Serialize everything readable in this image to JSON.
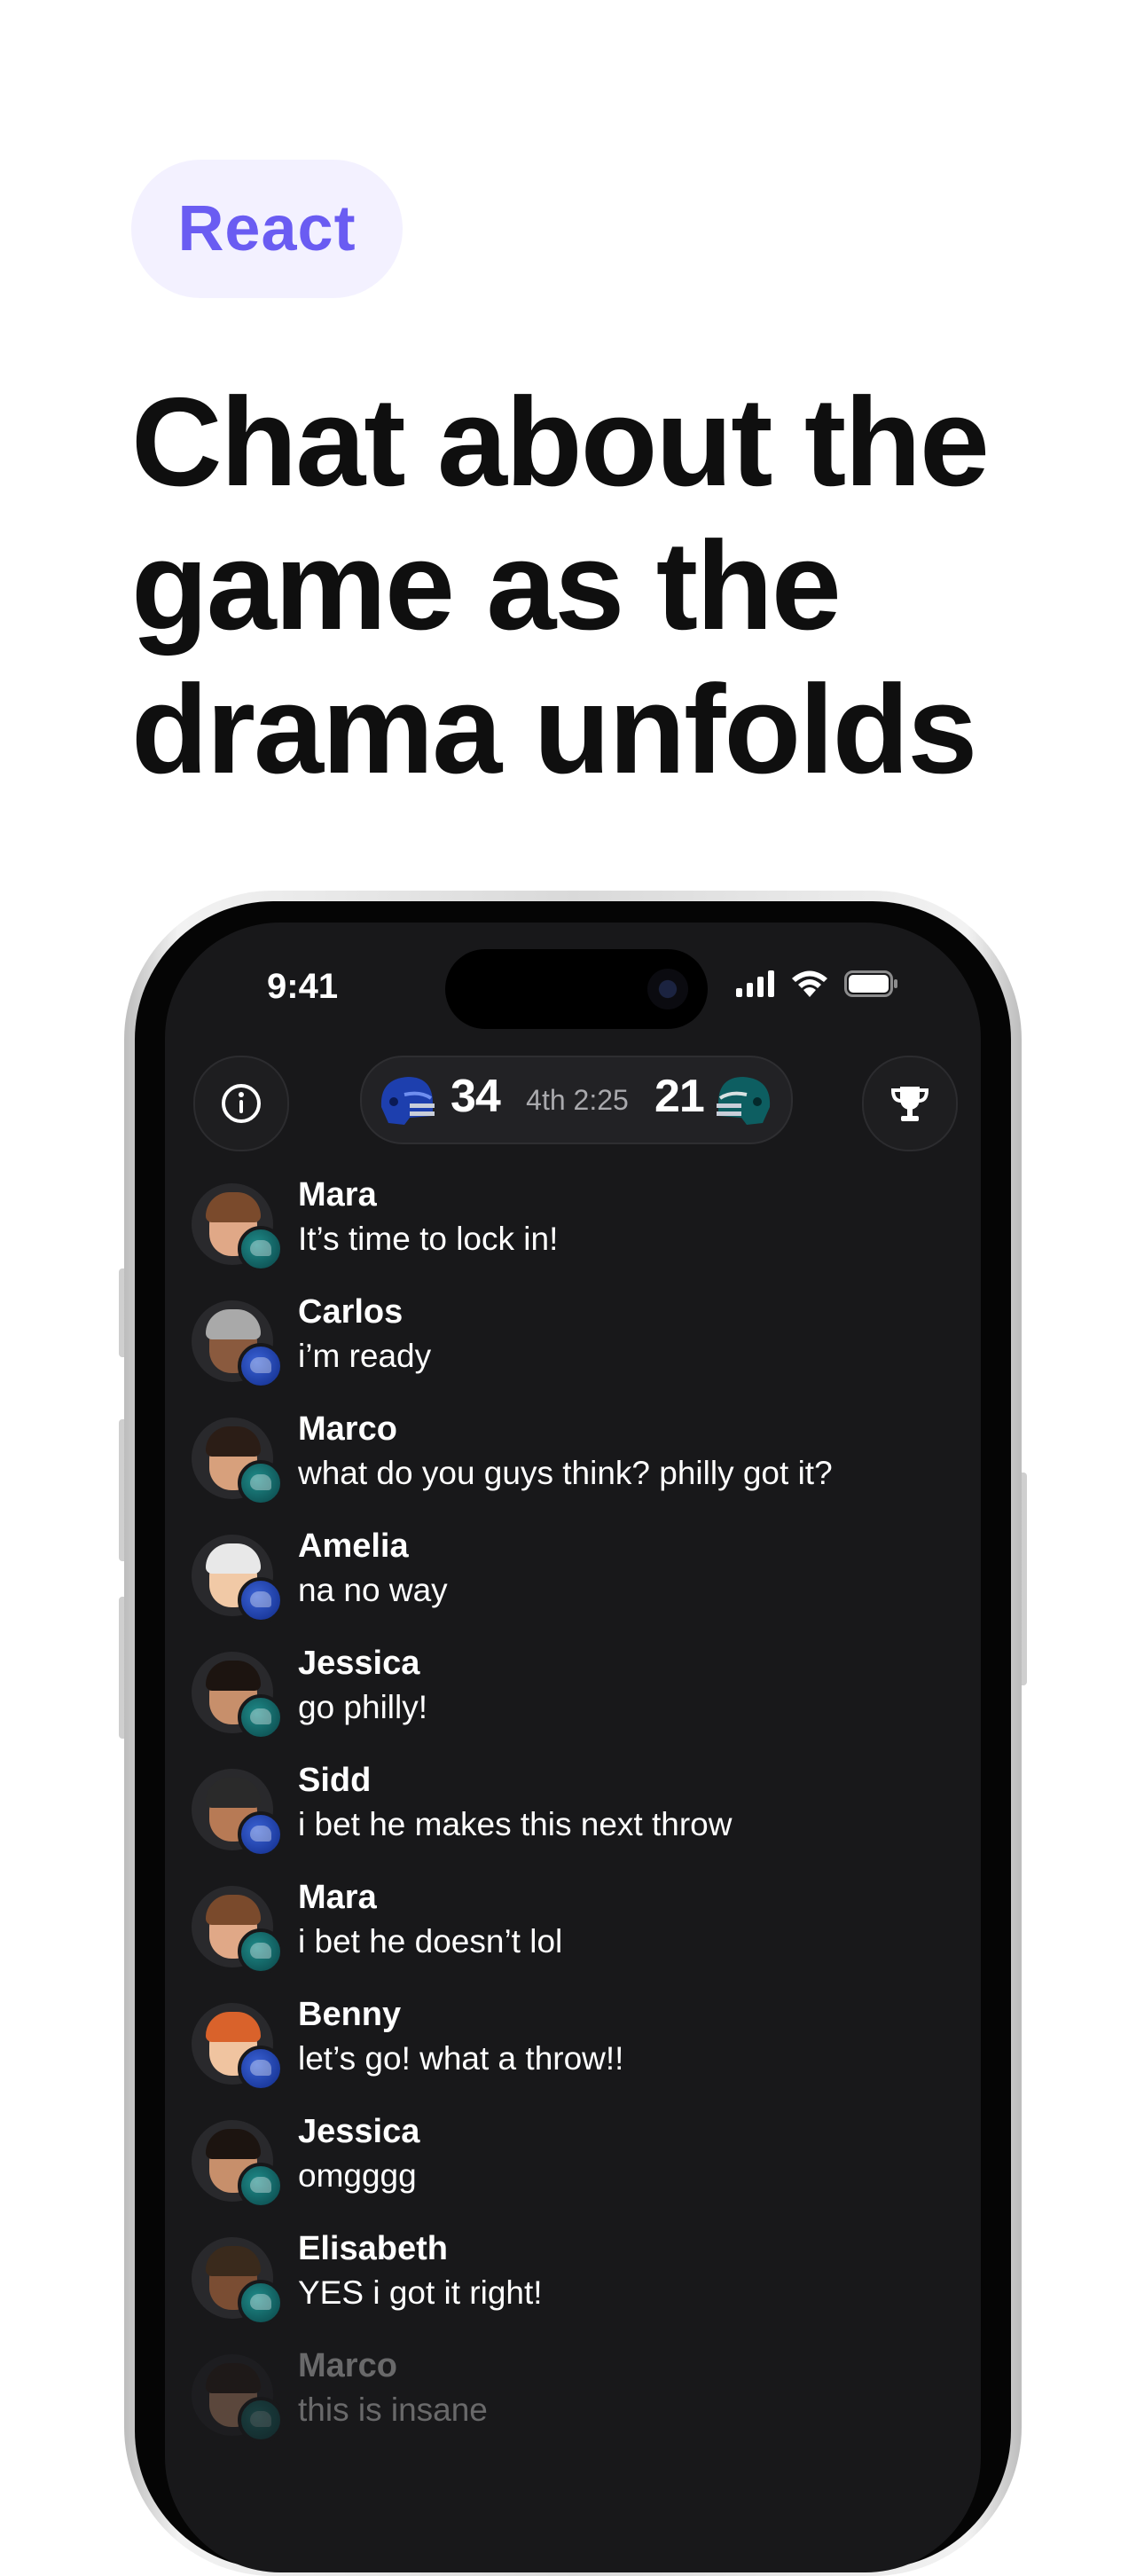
{
  "tag": {
    "label": "React"
  },
  "headline": {
    "lines": [
      "Chat about the",
      "game as the",
      "drama unfolds"
    ]
  },
  "status_bar": {
    "time": "9:41"
  },
  "scoreboard": {
    "home_score": "34",
    "period_clock": "4th 2:25",
    "away_score": "21",
    "home_color": "#1d3fae",
    "away_color": "#0d5e61"
  },
  "icons": {
    "info": "info-icon",
    "trophy": "trophy-icon"
  },
  "messages": [
    {
      "name": "Mara",
      "text": "It’s time to lock in!",
      "team": "green"
    },
    {
      "name": "Carlos",
      "text": "i’m ready",
      "team": "blue"
    },
    {
      "name": "Marco",
      "text": "what do you guys think? philly got it?",
      "team": "green"
    },
    {
      "name": "Amelia",
      "text": "na no way",
      "team": "blue"
    },
    {
      "name": "Jessica",
      "text": "go philly!",
      "team": "green"
    },
    {
      "name": "Sidd",
      "text": "i bet he makes this next throw",
      "team": "blue"
    },
    {
      "name": "Mara",
      "text": "i bet he doesn’t lol",
      "team": "green"
    },
    {
      "name": "Benny",
      "text": "let’s go! what a throw!!",
      "team": "blue"
    },
    {
      "name": "Jessica",
      "text": "omgggg",
      "team": "green"
    },
    {
      "name": "Elisabeth",
      "text": "YES i got it right!",
      "team": "green"
    },
    {
      "name": "Marco",
      "text": "this is insane",
      "team": "green"
    }
  ]
}
